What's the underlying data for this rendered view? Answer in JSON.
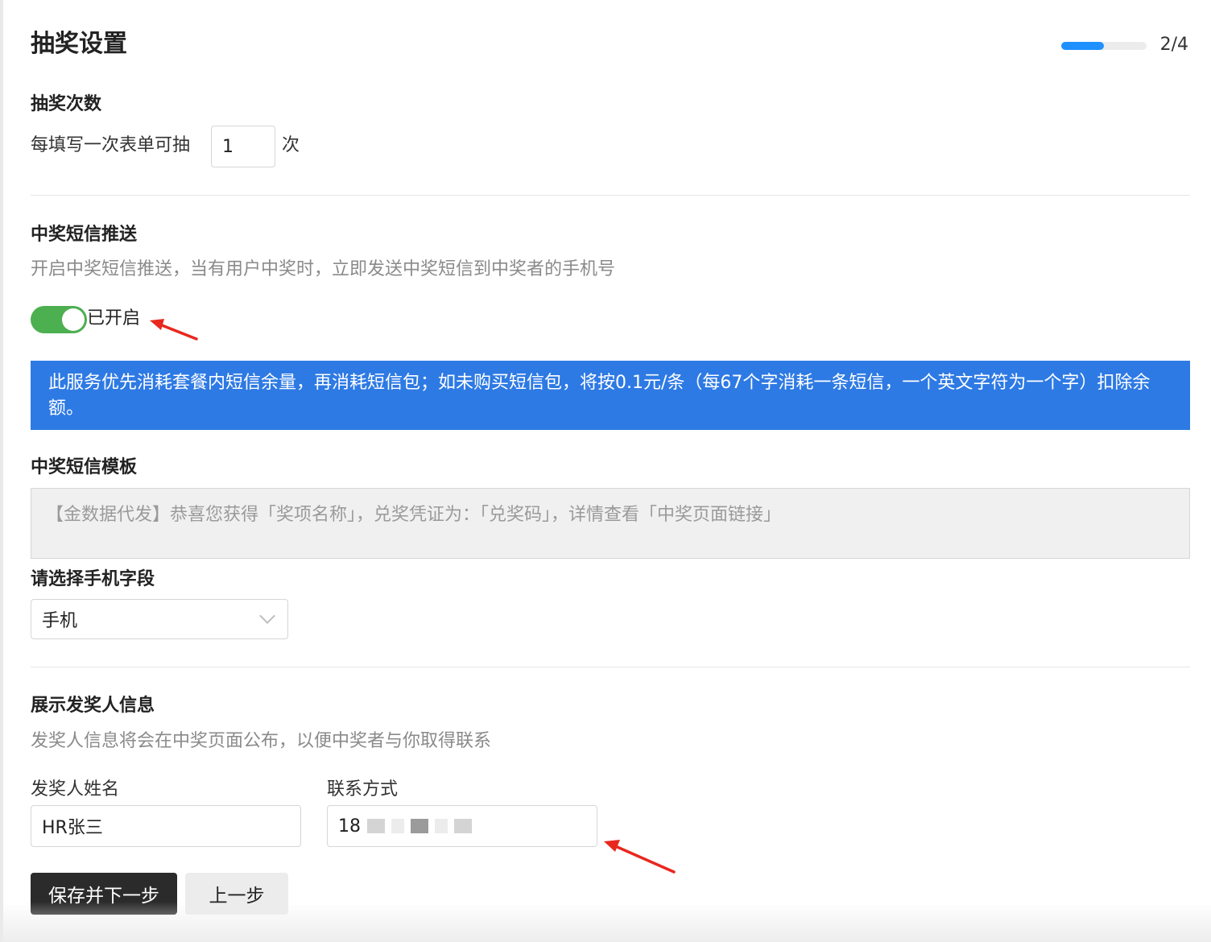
{
  "page": {
    "title": "抽奖设置",
    "progress_text": "2/4",
    "progress_fraction": 0.5
  },
  "draw_count": {
    "title": "抽奖次数",
    "prefix": "每填写一次表单可抽",
    "value": "1",
    "suffix": "次"
  },
  "sms_push": {
    "title": "中奖短信推送",
    "description": "开启中奖短信推送，当有用户中奖时，立即发送中奖短信到中奖者的手机号",
    "toggle_on": true,
    "toggle_label": "已开启",
    "notice": "此服务优先消耗套餐内短信余量，再消耗短信包；如未购买短信包，将按0.1元/条（每67个字消耗一条短信，一个英文字符为一个字）扣除余额。"
  },
  "template": {
    "title": "中奖短信模板",
    "text": "【金数据代发】恭喜您获得「奖项名称」，兑奖凭证为：「兑奖码」，详情查看「中奖页面链接」"
  },
  "phone_field": {
    "title": "请选择手机字段",
    "selected": "手机"
  },
  "issuer": {
    "title": "展示发奖人信息",
    "description": "发奖人信息将会在中奖页面公布，以便中奖者与你取得联系",
    "name_label": "发奖人姓名",
    "name_value": "HR张三",
    "contact_label": "联系方式",
    "contact_visible_prefix": "18"
  },
  "actions": {
    "save_next": "保存并下一步",
    "previous": "上一步"
  },
  "colors": {
    "accent_blue": "#2e7ae4",
    "toggle_green": "#4caf50",
    "progress_blue": "#1e90ff",
    "primary_button": "#2b2b2b",
    "annotation_red": "#e8281e"
  }
}
